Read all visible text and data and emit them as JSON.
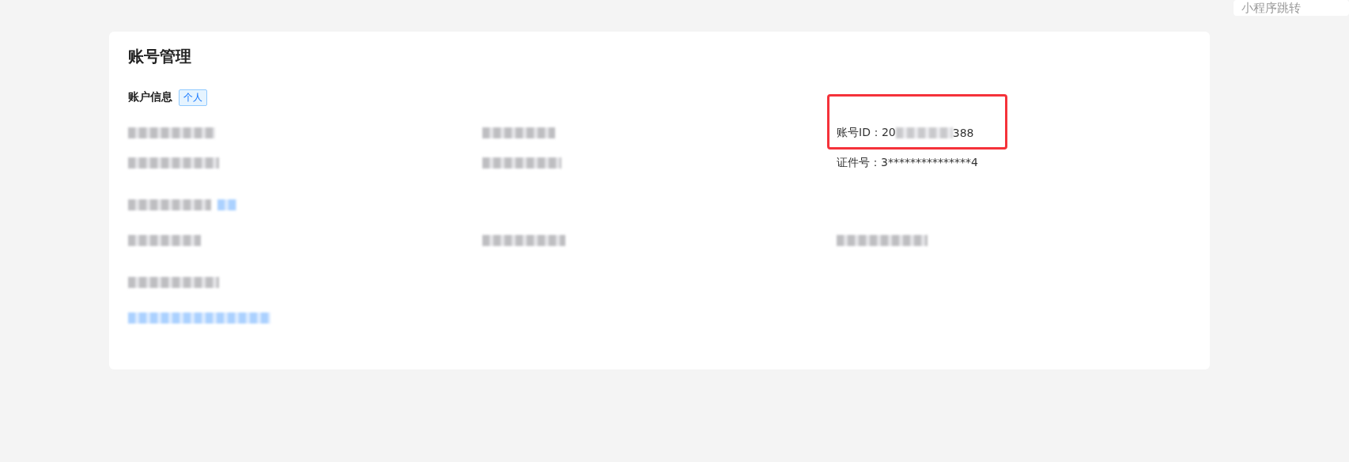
{
  "corner_button": {
    "label": "小程序跳转"
  },
  "card": {
    "title": "账号管理",
    "sections": [
      {
        "heading": {
          "kind": "text",
          "text": "账户信息"
        },
        "tag": "个人",
        "rows": [
          [
            {
              "kind": "redacted"
            },
            {
              "kind": "redacted"
            },
            {
              "kind": "split_id",
              "label": "账号ID：",
              "prefix": "20",
              "suffix": "388",
              "highlighted": true
            }
          ],
          [
            {
              "kind": "redacted"
            },
            {
              "kind": "redacted"
            },
            {
              "kind": "text",
              "text": "证件号：3***************4",
              "highlighted": false
            }
          ]
        ]
      },
      {
        "heading": {
          "kind": "redacted",
          "link": true
        },
        "rows": [
          [
            {
              "kind": "redacted"
            },
            {
              "kind": "redacted"
            },
            {
              "kind": "redacted"
            }
          ]
        ]
      },
      {
        "heading": {
          "kind": "redacted"
        },
        "rows": [
          [
            {
              "kind": "redacted_link"
            }
          ]
        ]
      }
    ]
  }
}
